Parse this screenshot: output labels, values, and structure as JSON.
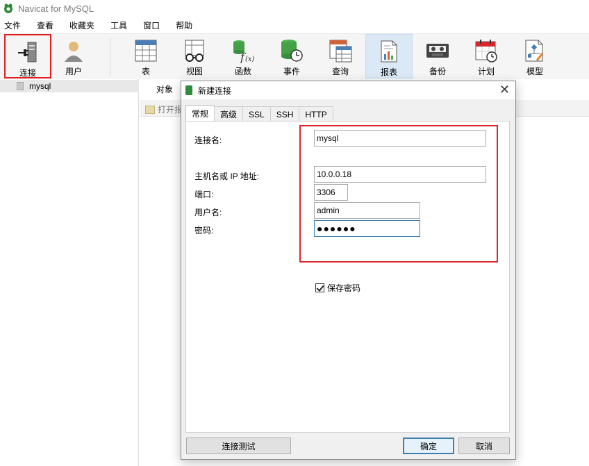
{
  "window": {
    "title": "Navicat for MySQL"
  },
  "menu": [
    "文件",
    "查看",
    "收藏夹",
    "工具",
    "窗口",
    "帮助"
  ],
  "toolbar": {
    "items": [
      {
        "label": "连接",
        "icon": "plug-server-icon"
      },
      {
        "label": "用户",
        "icon": "user-icon"
      },
      {
        "label": "表",
        "icon": "table-icon"
      },
      {
        "label": "视图",
        "icon": "view-glasses-icon"
      },
      {
        "label": "函数",
        "icon": "function-icon"
      },
      {
        "label": "事件",
        "icon": "event-clock-icon"
      },
      {
        "label": "查询",
        "icon": "query-icon"
      },
      {
        "label": "报表",
        "icon": "report-icon"
      },
      {
        "label": "备份",
        "icon": "backup-tape-icon"
      },
      {
        "label": "计划",
        "icon": "calendar-icon"
      },
      {
        "label": "模型",
        "icon": "model-icon"
      }
    ]
  },
  "tree": {
    "connection": "mysql"
  },
  "objects": {
    "tab": "对象",
    "open_button": "打开报"
  },
  "dialog": {
    "title": "新建连接",
    "tabs": [
      "常规",
      "高级",
      "SSL",
      "SSH",
      "HTTP"
    ],
    "fields": {
      "conn_name_label": "连接名:",
      "conn_name_value": "mysql",
      "host_label": "主机名或 IP 地址:",
      "host_value": "10.0.0.18",
      "port_label": "端口:",
      "port_value": "3306",
      "user_label": "用户名:",
      "user_value": "admin",
      "password_label": "密码:",
      "password_value": "●●●●●●"
    },
    "save_password_label": "保存密码",
    "test_button": "连接测试",
    "ok_button": "确定",
    "cancel_button": "取消"
  },
  "colors": {
    "accent": "#3c7fb1",
    "highlight": "#d9262c",
    "active_tool": "#dbe9f7"
  }
}
